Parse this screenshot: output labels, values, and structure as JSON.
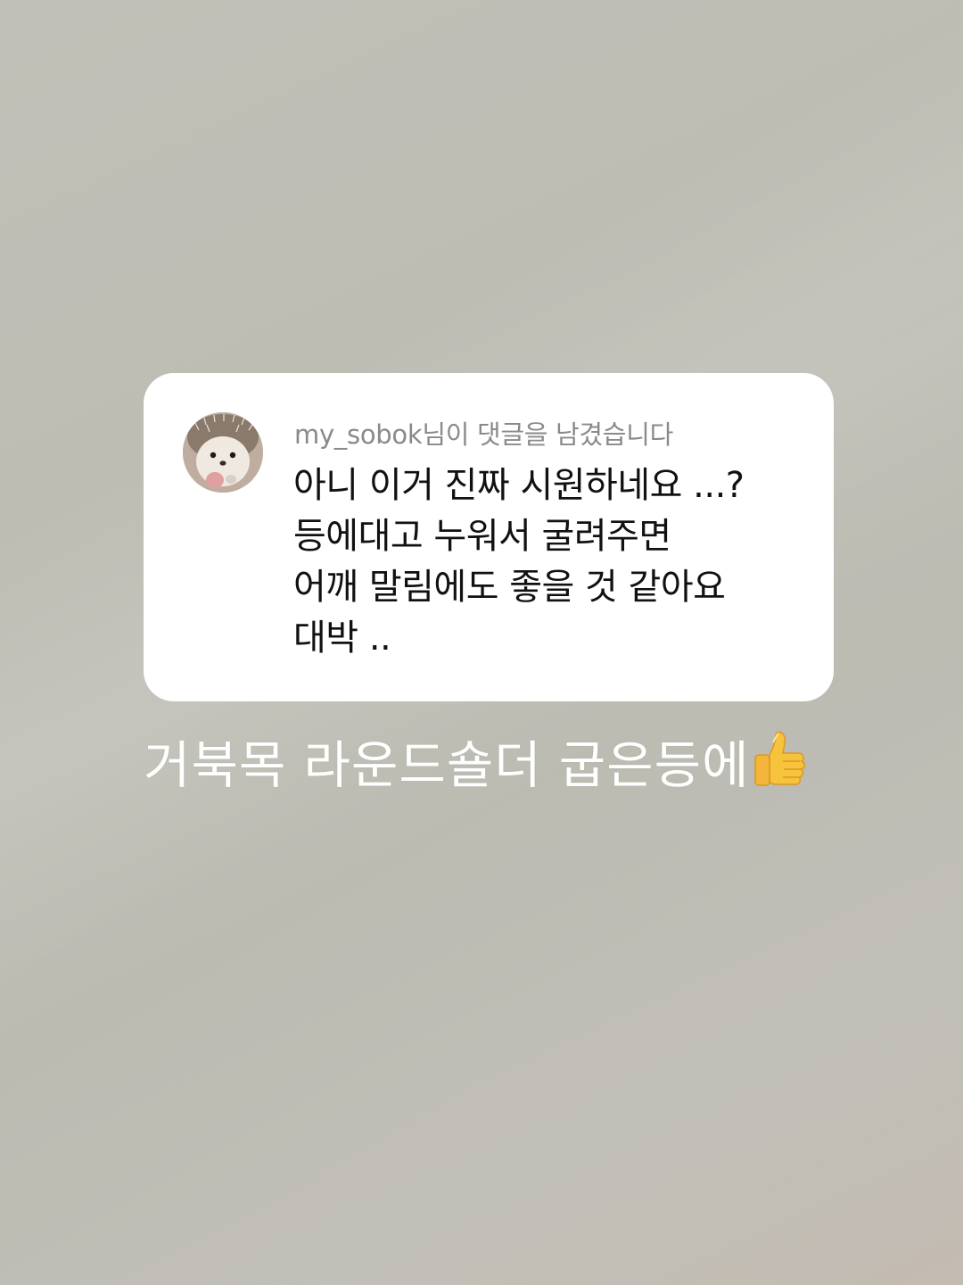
{
  "comment": {
    "username": "my_sobok",
    "header_suffix": "님이 댓글을 남겼습니다",
    "lines": [
      "아니 이거 진짜 시원하네요 ...?",
      "등에대고 누워서 굴려주면",
      "어깨 말림에도 좋을 것 같아요",
      "대박 .."
    ],
    "avatar_icon": "hedgehog-avatar"
  },
  "caption": {
    "text": "거북목 라운드숄더 굽은등에",
    "emoji_icon": "thumbs-up-icon"
  },
  "colors": {
    "background": "#bfbfb7",
    "card": "#ffffff",
    "header_text": "#8a8a8a",
    "body_text": "#111111",
    "caption_text": "#ffffff"
  }
}
